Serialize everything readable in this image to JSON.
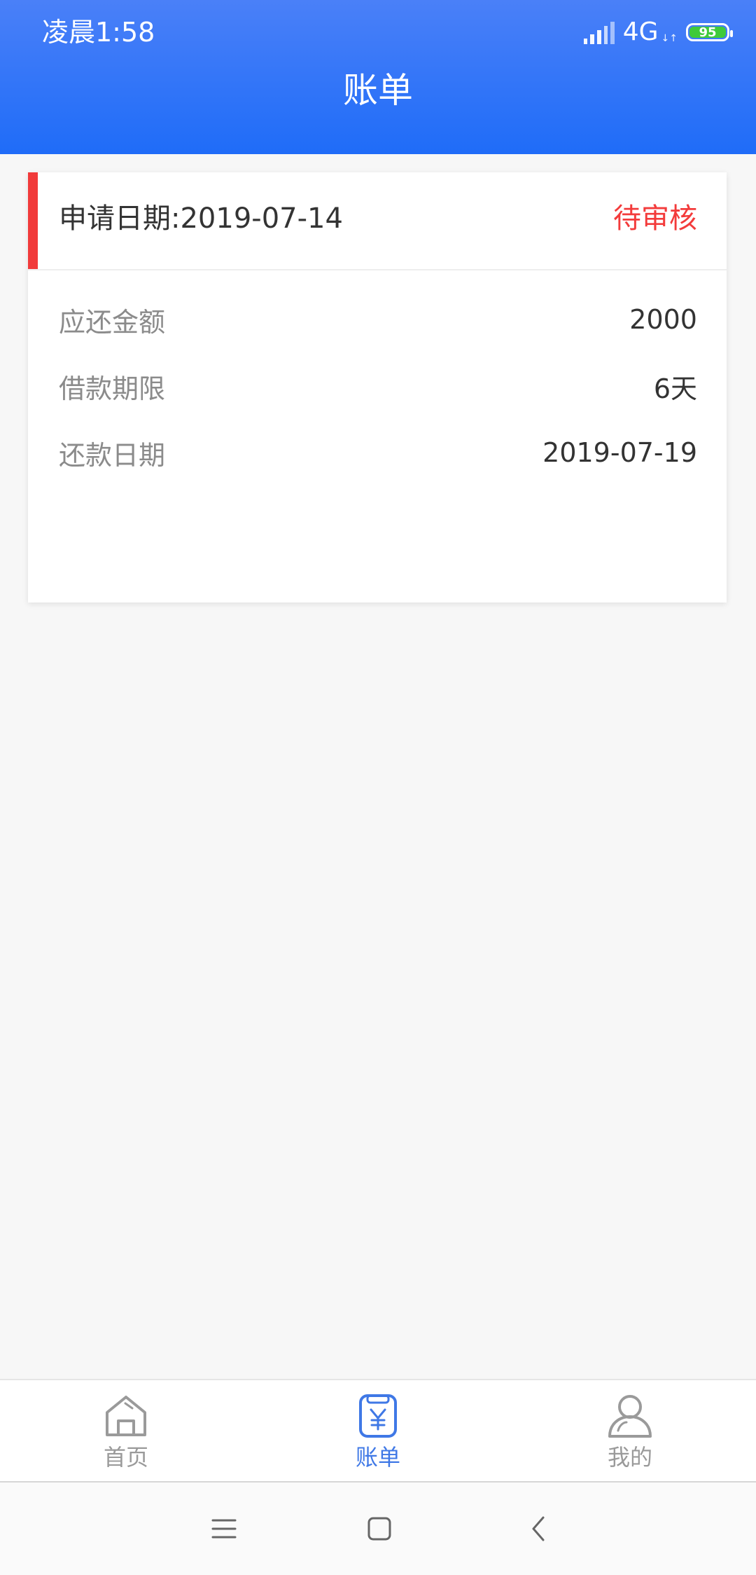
{
  "status_bar": {
    "time": "凌晨1:58",
    "network": "4G",
    "battery": "95"
  },
  "header": {
    "title": "账单"
  },
  "bill_card": {
    "apply_date_label": "申请日期:2019-07-14",
    "status": "待审核",
    "rows": [
      {
        "label": "应还金额",
        "value": "2000"
      },
      {
        "label": "借款期限",
        "value": "6天"
      },
      {
        "label": "还款日期",
        "value": "2019-07-19"
      }
    ]
  },
  "tabbar": {
    "tabs": [
      {
        "label": "首页",
        "icon": "home-icon"
      },
      {
        "label": "账单",
        "icon": "bill-icon",
        "active": true
      },
      {
        "label": "我的",
        "icon": "user-icon"
      }
    ]
  },
  "navbar": {
    "buttons": [
      "menu-icon",
      "home-square-icon",
      "back-icon"
    ]
  },
  "colors": {
    "header_gradient_top": "#4a80f8",
    "header_gradient_bottom": "#1f6cf8",
    "status_red": "#f33b3b",
    "tab_active": "#3f78e6",
    "tab_inactive": "#9a9a9a"
  }
}
